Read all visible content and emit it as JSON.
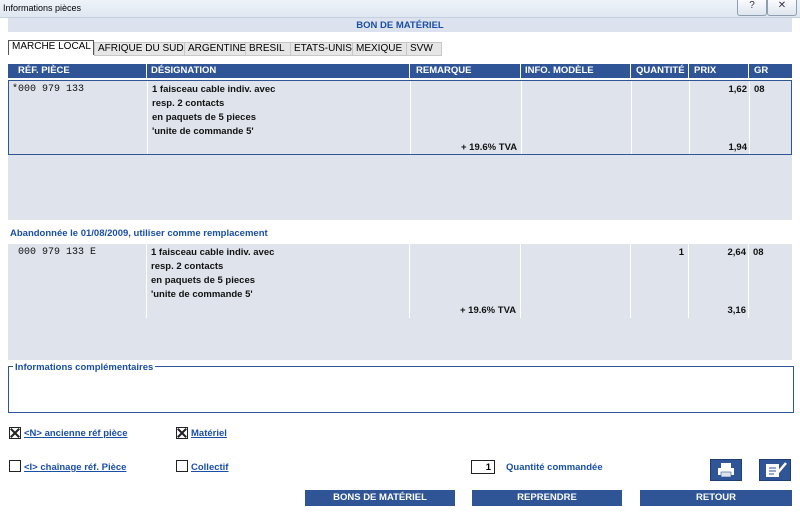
{
  "window": {
    "title": "Informations pièces",
    "help_glyph": "?",
    "close_glyph": "✕"
  },
  "header": {
    "title": "BON DE MATÉRIEL"
  },
  "tabs": [
    "MARCHE LOCAL",
    "AFRIQUE DU SUD",
    "ARGENTINE",
    "BRESIL",
    "ETATS-UNIS",
    "MEXIQUE",
    "SVW"
  ],
  "columns": [
    "RÉF. PIÈCE",
    "DÉSIGNATION",
    "REMARQUE",
    "INFO. MODÈLE",
    "QUANTITÉ",
    "PRIX",
    "GR"
  ],
  "part": {
    "ref": "*000 979 133",
    "designation": [
      "1 faisceau cable indiv. avec",
      "resp. 2 contacts",
      "en paquets de 5 pieces",
      "'unite de commande 5'"
    ],
    "remarque": "+ 19.6% TVA",
    "quantite": "",
    "prix": "1,62",
    "prix_tva": "1,94",
    "gr": "08"
  },
  "replacement": {
    "notice": "Abandonnée le 01/08/2009, utiliser comme remplacement",
    "ref": "000 979 133 E",
    "designation": [
      "1 faisceau cable indiv. avec",
      "resp. 2 contacts",
      "en paquets de 5 pieces",
      "'unite de commande 5'"
    ],
    "remarque": "+ 19.6% TVA",
    "quantite": "1",
    "prix": "2,64",
    "prix_tva": "3,16",
    "gr": "08"
  },
  "info": {
    "label": "Informations complémentaires"
  },
  "checkboxes": {
    "ancienne_ref": {
      "label": "<N> ancienne réf pièce",
      "checked": true
    },
    "materiel": {
      "label": "Matériel",
      "checked": true
    },
    "chainage": {
      "label": "<I> chaînage réf. Pièce",
      "checked": false
    },
    "collectif": {
      "label": "Collectif",
      "checked": false
    }
  },
  "quantity": {
    "value": "1",
    "label": "Quantité commandée"
  },
  "buttons": {
    "bons": "BONS DE MATÉRIEL",
    "reprendre": "REPRENDRE",
    "retour": "RETOUR"
  },
  "colors": {
    "header_blue": "#2f5597",
    "row_bg": "#dfe4ec",
    "text_blue": "#1a4fa6"
  },
  "icons": {
    "print": "printer-icon",
    "edit": "edit-icon"
  }
}
